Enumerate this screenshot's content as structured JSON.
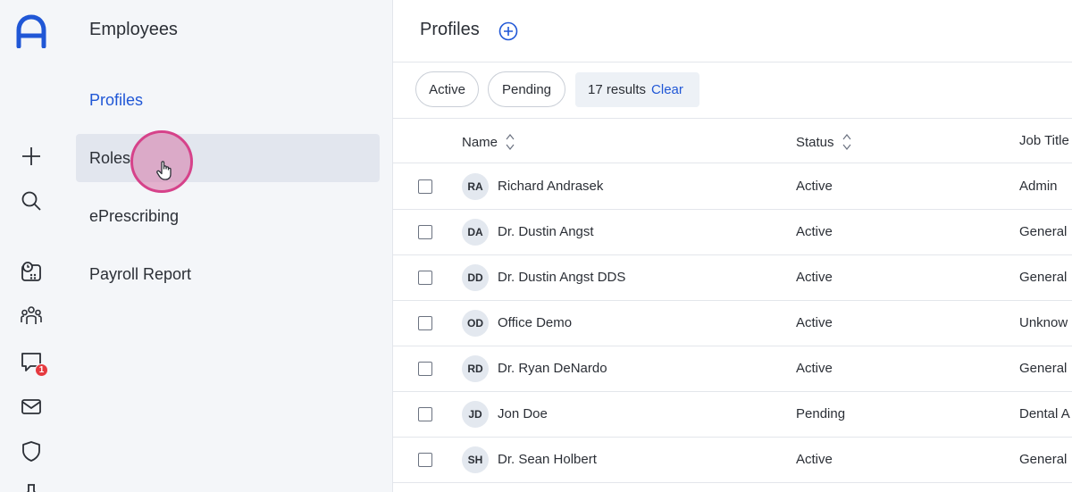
{
  "subnav": {
    "title": "Employees",
    "items": [
      {
        "label": "Profiles"
      },
      {
        "label": "Roles"
      },
      {
        "label": "ePrescribing"
      },
      {
        "label": "Payroll Report"
      }
    ]
  },
  "rail": {
    "icons": [
      "logo-icon",
      "plus-icon",
      "search-icon",
      "calendar-clock-icon",
      "people-icon",
      "chat-icon",
      "mail-icon",
      "shield-icon",
      "pin-icon"
    ],
    "chat_badge": "1"
  },
  "main": {
    "title": "Profiles",
    "filters": [
      {
        "label": "Active"
      },
      {
        "label": "Pending"
      }
    ],
    "results_label": "17 results",
    "clear_label": "Clear",
    "columns": [
      "Name",
      "Status",
      "Job Title"
    ],
    "rows": [
      {
        "initials": "RA",
        "name": "Richard Andrasek",
        "status": "Active",
        "job": "Admin"
      },
      {
        "initials": "DA",
        "name": "Dr. Dustin Angst",
        "status": "Active",
        "job": "General"
      },
      {
        "initials": "DD",
        "name": "Dr. Dustin Angst DDS",
        "status": "Active",
        "job": "General"
      },
      {
        "initials": "OD",
        "name": "Office Demo",
        "status": "Active",
        "job": "Unknow"
      },
      {
        "initials": "RD",
        "name": "Dr. Ryan DeNardo",
        "status": "Active",
        "job": "General"
      },
      {
        "initials": "JD",
        "name": "Jon Doe",
        "status": "Pending",
        "job": "Dental A"
      },
      {
        "initials": "SH",
        "name": "Dr. Sean Holbert",
        "status": "Active",
        "job": "General"
      }
    ]
  },
  "colors": {
    "accent": "#2057d6",
    "badge": "#e5393f",
    "sidebar_bg": "#f4f6f9"
  }
}
